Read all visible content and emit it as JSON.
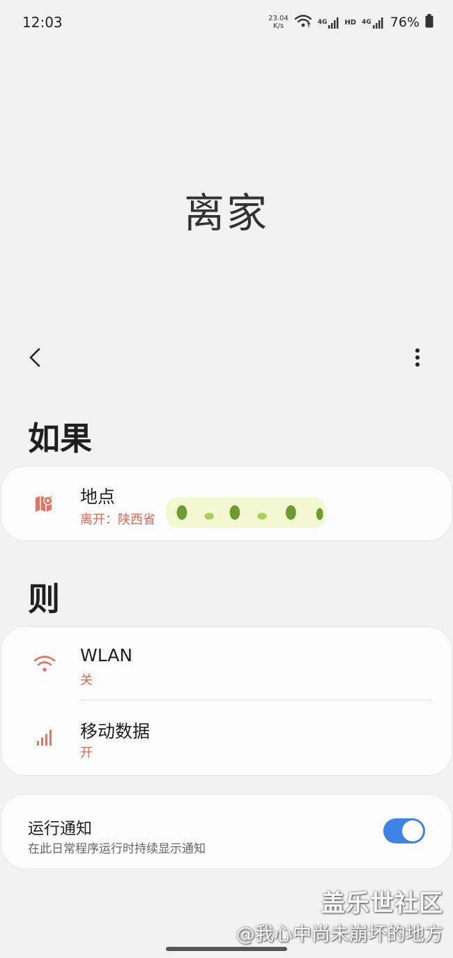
{
  "status_bar": {
    "time": "12:03",
    "net_speed_value": "23.04",
    "net_speed_unit": "K/s",
    "signal_tag_1": "4G",
    "hd_tag": "HD",
    "signal_tag_2": "4G",
    "battery": "76%"
  },
  "page": {
    "title": "离家"
  },
  "sections": {
    "if_header": "如果",
    "then_header": "则"
  },
  "condition": {
    "title": "地点",
    "subtitle": "离开：陕西省"
  },
  "actions": [
    {
      "title": "WLAN",
      "state": "关"
    },
    {
      "title": "移动数据",
      "state": "开"
    }
  ],
  "notification": {
    "title": "运行通知",
    "description": "在此日常程序运行时持续显示通知",
    "enabled": true
  },
  "watermark": {
    "brand": "盖乐世社区",
    "user": "@我心中尚未崩坏的地方"
  },
  "colors": {
    "accent": "#d96a55",
    "toggle_on": "#3e82e6",
    "background": "#f2f2f2"
  }
}
